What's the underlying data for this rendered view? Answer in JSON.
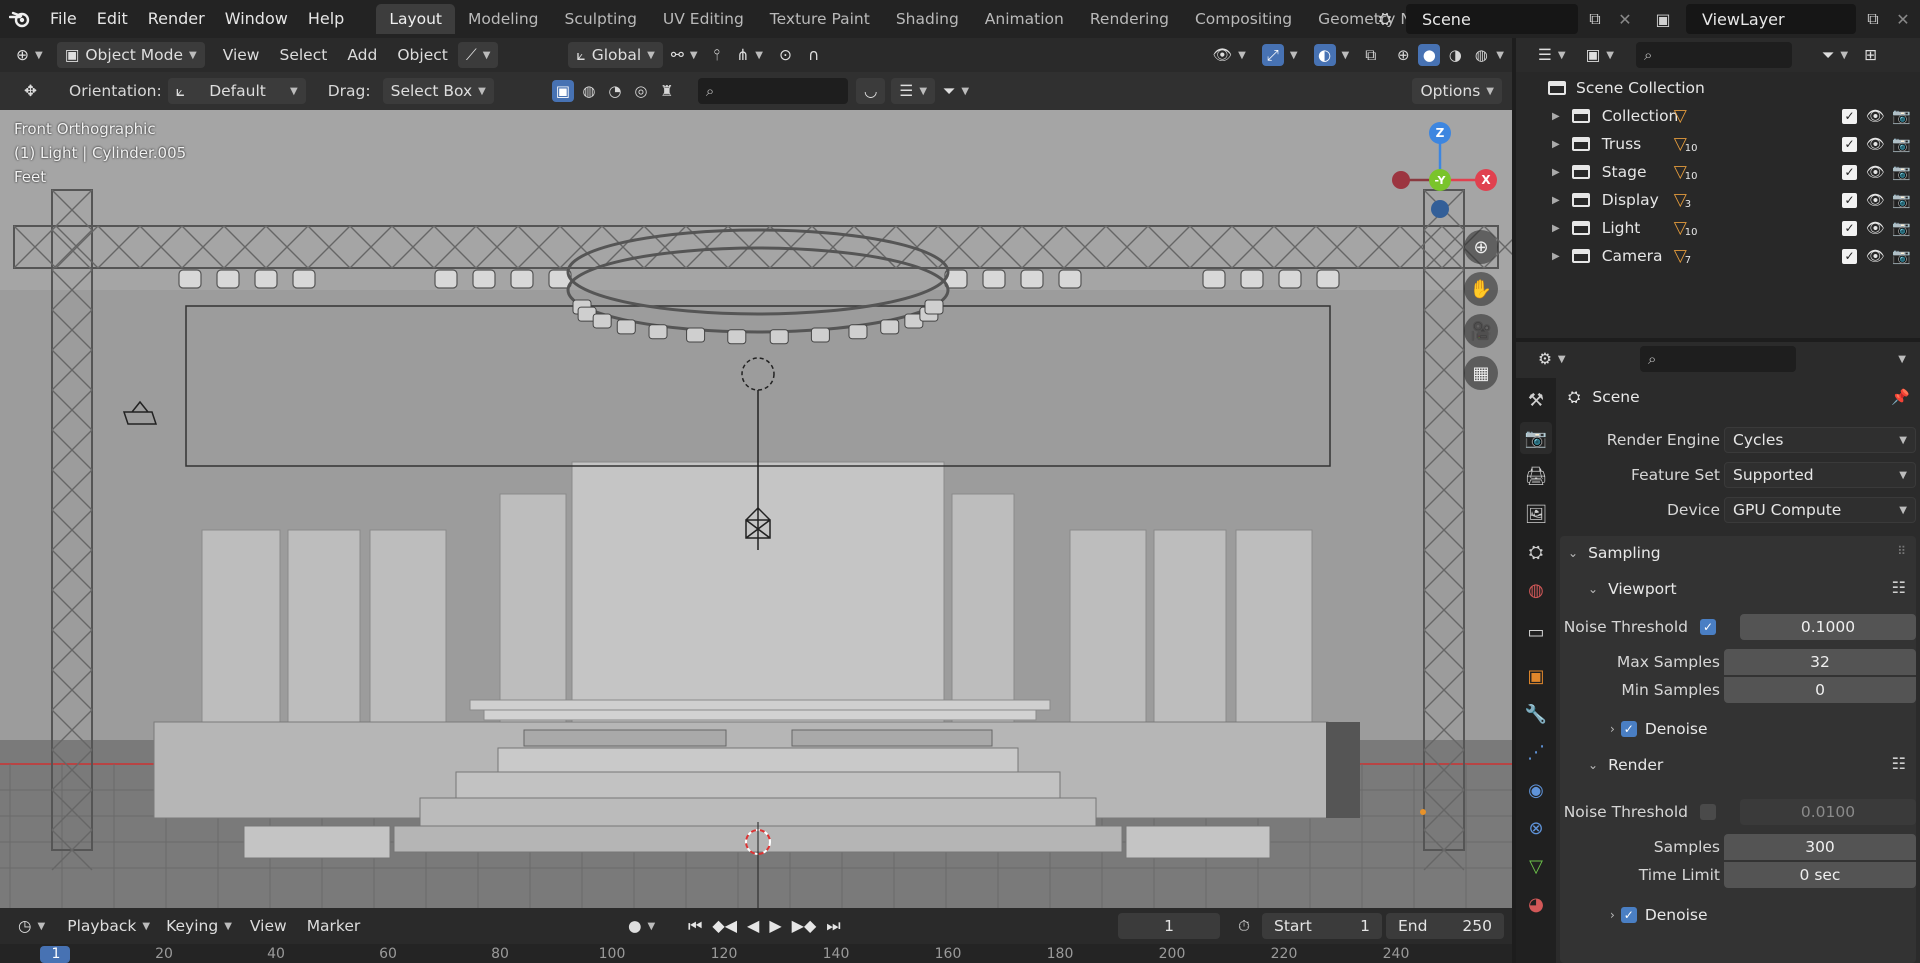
{
  "topbar": {
    "menus": [
      "File",
      "Edit",
      "Render",
      "Window",
      "Help"
    ],
    "tabs": [
      "Layout",
      "Modeling",
      "Sculpting",
      "UV Editing",
      "Texture Paint",
      "Shading",
      "Animation",
      "Rendering",
      "Compositing",
      "Geometry Noc"
    ],
    "active_tab": "Layout",
    "scene": "Scene",
    "view_layer": "ViewLayer"
  },
  "viewport_header": {
    "mode": "Object Mode",
    "menus": [
      "View",
      "Select",
      "Add",
      "Object"
    ],
    "transform": "Global"
  },
  "tool_header": {
    "orientation_label": "Orientation:",
    "orientation_value": "Default",
    "drag_label": "Drag:",
    "drag_value": "Select Box",
    "options": "Options"
  },
  "overlay": {
    "view_name": "Front Orthographic",
    "active_object": "(1) Light | Cylinder.005",
    "units": "Feet"
  },
  "gizmo": {
    "z": "Z",
    "y": "-Y",
    "x": "X"
  },
  "timeline": {
    "menus": [
      "Playback",
      "Keying",
      "View",
      "Marker"
    ],
    "current_frame": "1",
    "start_label": "Start",
    "start": "1",
    "end_label": "End",
    "end": "250",
    "ruler": [
      "1",
      "20",
      "40",
      "60",
      "80",
      "100",
      "120",
      "140",
      "160",
      "180",
      "200",
      "220",
      "240"
    ]
  },
  "outliner": {
    "root": "Scene Collection",
    "items": [
      {
        "name": "Collection",
        "badge": ""
      },
      {
        "name": "Truss",
        "badge": "10"
      },
      {
        "name": "Stage",
        "badge": "10"
      },
      {
        "name": "Display",
        "badge": "3"
      },
      {
        "name": "Light",
        "badge": "10"
      },
      {
        "name": "Camera",
        "badge": "7"
      }
    ]
  },
  "properties": {
    "title": "Scene",
    "render_engine_label": "Render Engine",
    "render_engine": "Cycles",
    "feature_set_label": "Feature Set",
    "feature_set": "Supported",
    "device_label": "Device",
    "device": "GPU Compute",
    "sampling": "Sampling",
    "viewport": "Viewport",
    "noise_threshold_label": "Noise Threshold",
    "viewport_noise_threshold": "0.1000",
    "max_samples_label": "Max Samples",
    "max_samples": "32",
    "min_samples_label": "Min Samples",
    "min_samples": "0",
    "denoise": "Denoise",
    "render": "Render",
    "render_noise_threshold": "0.0100",
    "samples_label": "Samples",
    "samples": "300",
    "time_limit_label": "Time Limit",
    "time_limit": "0 sec"
  },
  "colors": {
    "accent_blue": "#4772b3",
    "axis_x": "#e0414f",
    "axis_y": "#7ac42b",
    "axis_z": "#3d86e0",
    "orange_icon": "#e29a3c"
  }
}
